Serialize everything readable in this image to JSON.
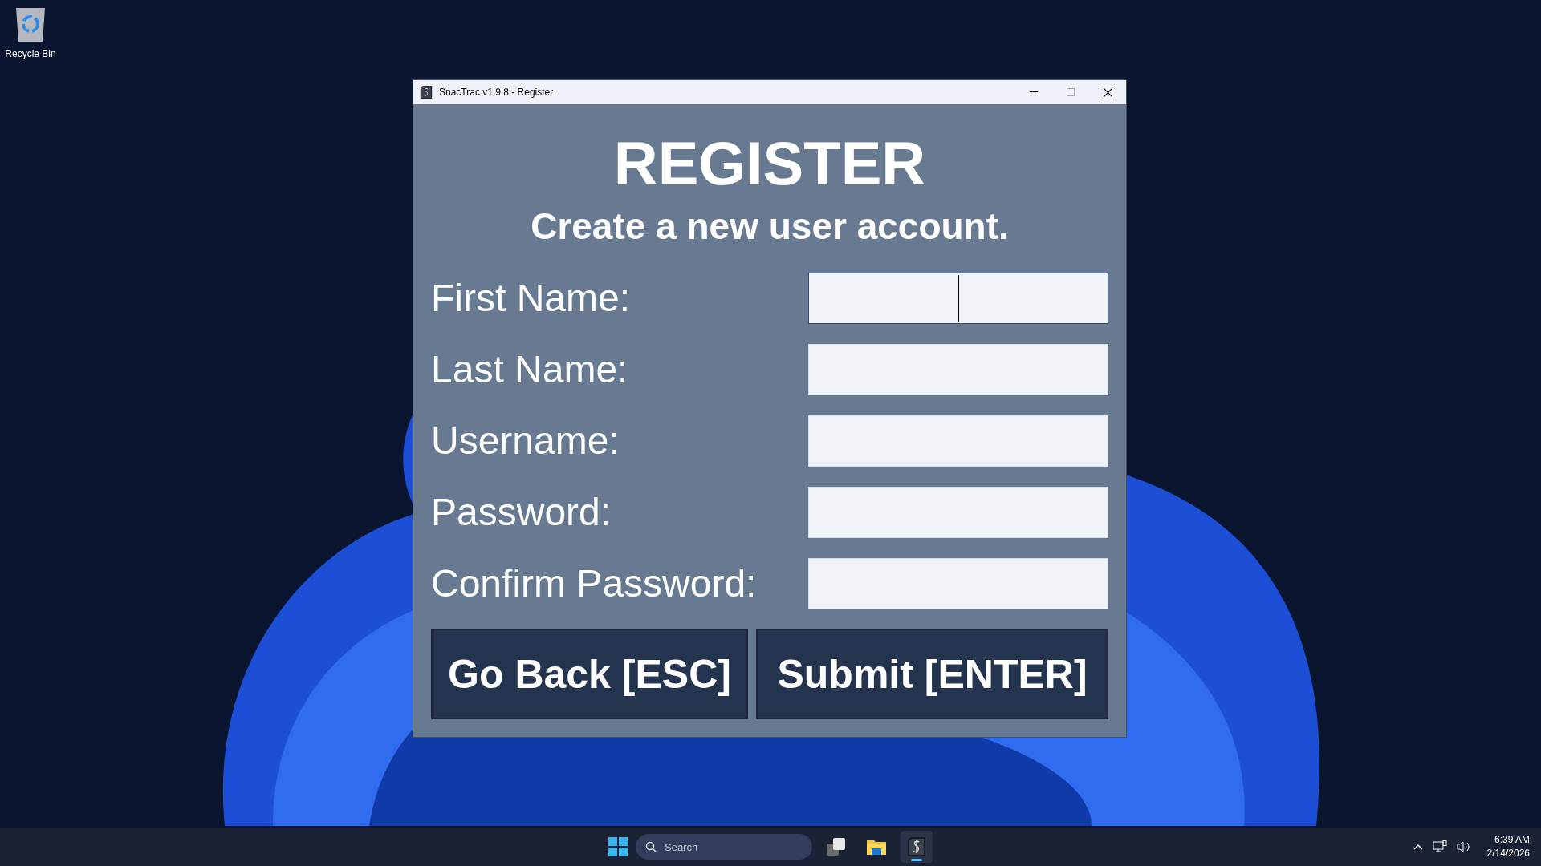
{
  "desktop": {
    "icons": [
      {
        "label": "Recycle Bin"
      }
    ]
  },
  "window": {
    "title": "SnacTrac v1.9.8 - Register",
    "heading": "REGISTER",
    "subheading": "Create a new user account.",
    "fields": [
      {
        "label": "First Name:",
        "focused": true
      },
      {
        "label": "Last Name:",
        "focused": false
      },
      {
        "label": "Username:",
        "focused": false
      },
      {
        "label": "Password:",
        "focused": false
      },
      {
        "label": "Confirm Password:",
        "focused": false
      }
    ],
    "buttons": [
      "Go Back [ESC]",
      "Submit [ENTER]"
    ]
  },
  "taskbar": {
    "search": {
      "placeholder": "Search"
    },
    "apps": [
      {
        "kind": "taskview",
        "active": false
      },
      {
        "kind": "explorer",
        "active": false
      },
      {
        "kind": "snactrac",
        "active": true
      }
    ],
    "time": "6:39 AM",
    "date": "2/14/2026"
  }
}
